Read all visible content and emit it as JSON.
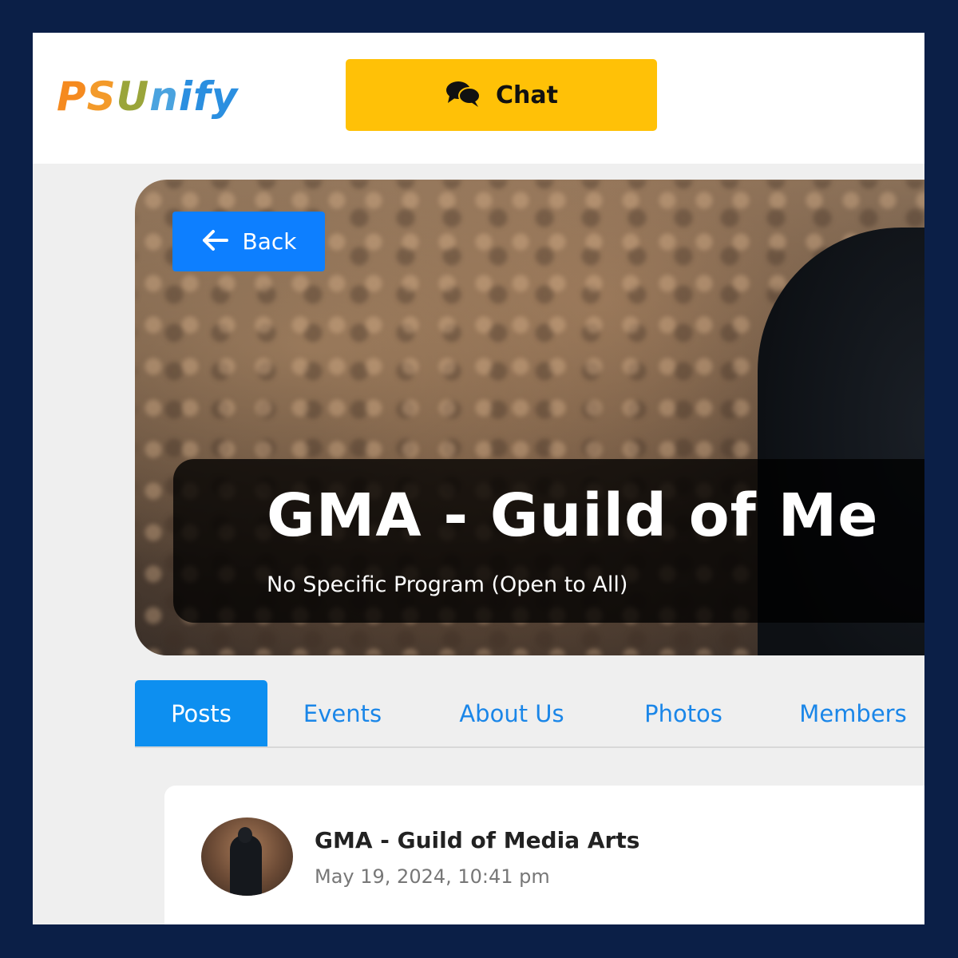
{
  "header": {
    "logo": [
      "P",
      "S",
      "U",
      "n",
      "ify"
    ],
    "chat_label": "Chat"
  },
  "hero": {
    "back_label": "Back",
    "title": "GMA - Guild of Me",
    "subtitle": "No Specific Program (Open to All)"
  },
  "tabs": [
    {
      "label": "Posts",
      "active": true
    },
    {
      "label": "Events",
      "active": false
    },
    {
      "label": "About Us",
      "active": false
    },
    {
      "label": "Photos",
      "active": false
    },
    {
      "label": "Members",
      "active": false
    }
  ],
  "post": {
    "author": "GMA - Guild of Media Arts",
    "date": "May 19, 2024, 10:41 pm"
  },
  "colors": {
    "page_border": "#0b1f47",
    "chat_button": "#ffc107",
    "back_button": "#0d7fff",
    "tab_active": "#0d8ff0",
    "tab_text": "#1a86e8"
  }
}
